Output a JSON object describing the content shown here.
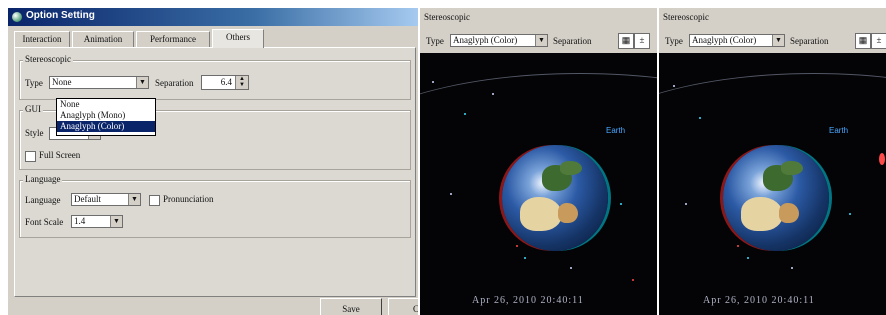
{
  "dialog": {
    "title": "Option Setting",
    "tabs": [
      {
        "label": "Interaction"
      },
      {
        "label": "Animation"
      },
      {
        "label": "Performance"
      },
      {
        "label": "Others"
      }
    ],
    "stereoscopic": {
      "group_label": "Stereoscopic",
      "type_label": "Type",
      "type_value": "None",
      "type_options": [
        "None",
        "Anaglyph (Mono)",
        "Anaglyph (Color)"
      ],
      "highlighted_option": "Anaglyph (Color)",
      "separation_label": "Separation",
      "separation_value": "6.4"
    },
    "gui": {
      "group_label": "GUI",
      "style_label": "Style",
      "fullscreen_label": "Full Screen"
    },
    "language": {
      "group_label": "Language",
      "language_label": "Language",
      "language_value": "Default",
      "pronunciation_label": "Pronunciation",
      "fontscale_label": "Font Scale",
      "fontscale_value": "1.4"
    },
    "save_label": "Save",
    "cancel_partial": "C"
  },
  "viewers": [
    {
      "title": "Stereoscopic",
      "type_label": "Type",
      "type_value": "Anaglyph (Color)",
      "separation_label": "Separation",
      "earth_label": "Earth",
      "date": "Apr 26, 2010 20:40:11"
    },
    {
      "title": "Stereoscopic",
      "type_label": "Type",
      "type_value": "Anaglyph (Color)",
      "separation_label": "Separation",
      "earth_label": "Earth",
      "date": "Apr 26, 2010 20:40:11"
    }
  ],
  "colors": {
    "titlebar": "#0a246a",
    "highlight": "#0a246a",
    "space": "#040406",
    "label": "#4aa7ff"
  }
}
